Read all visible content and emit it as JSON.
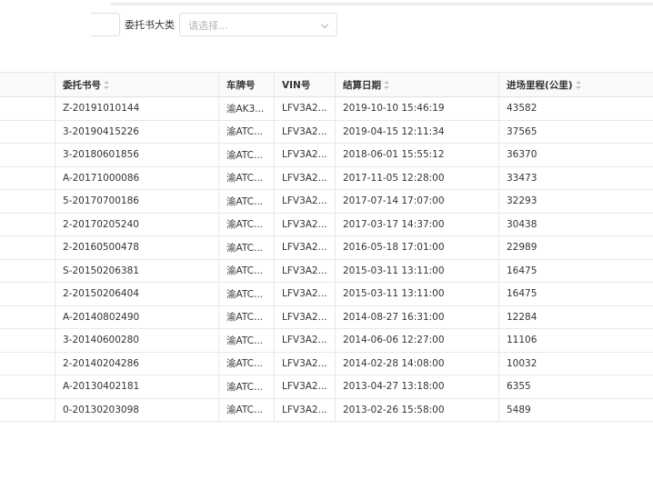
{
  "filter": {
    "label": "委托书大类",
    "placeholder": "请选择..."
  },
  "table": {
    "columns": [
      "",
      "委托书号",
      "车牌号",
      "VIN号",
      "结算日期",
      "进场里程(公里)"
    ],
    "rows": [
      [
        "",
        "Z-20191010144",
        "渝AK3...",
        "LFV3A2...",
        "2019-10-10 15:46:19",
        "43582"
      ],
      [
        "",
        "3-20190415226",
        "渝ATC...",
        "LFV3A2...",
        "2019-04-15 12:11:34",
        "37565"
      ],
      [
        "",
        "3-20180601856",
        "渝ATC...",
        "LFV3A2...",
        "2018-06-01 15:55:12",
        "36370"
      ],
      [
        "",
        "A-20171000086",
        "渝ATC...",
        "LFV3A2...",
        "2017-11-05 12:28:00",
        "33473"
      ],
      [
        "",
        "5-20170700186",
        "渝ATC...",
        "LFV3A2...",
        "2017-07-14 17:07:00",
        "32293"
      ],
      [
        "",
        "2-20170205240",
        "渝ATC...",
        "LFV3A2...",
        "2017-03-17 14:37:00",
        "30438"
      ],
      [
        "",
        "2-20160500478",
        "渝ATC...",
        "LFV3A2...",
        "2016-05-18 17:01:00",
        "22989"
      ],
      [
        "",
        "S-20150206381",
        "渝ATC...",
        "LFV3A2...",
        "2015-03-11 13:11:00",
        "16475"
      ],
      [
        "",
        "2-20150206404",
        "渝ATC...",
        "LFV3A2...",
        "2015-03-11 13:11:00",
        "16475"
      ],
      [
        "",
        "A-20140802490",
        "渝ATC...",
        "LFV3A2...",
        "2014-08-27 16:31:00",
        "12284"
      ],
      [
        "",
        "3-20140600280",
        "渝ATC...",
        "LFV3A2...",
        "2014-06-06 12:27:00",
        "11106"
      ],
      [
        "",
        "2-20140204286",
        "渝ATC...",
        "LFV3A2...",
        "2014-02-28 14:08:00",
        "10032"
      ],
      [
        "",
        "A-20130402181",
        "渝ATC...",
        "LFV3A2...",
        "2013-04-27 13:18:00",
        "6355"
      ],
      [
        "",
        "0-20130203098",
        "渝ATC...",
        "LFV3A2...",
        "2013-02-26 15:58:00",
        "5489"
      ]
    ]
  }
}
